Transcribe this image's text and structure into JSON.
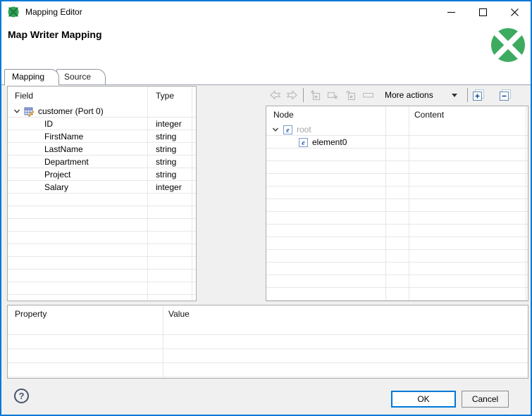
{
  "window": {
    "title": "Mapping Editor",
    "controls": {
      "minimize": "minimize",
      "maximize": "maximize",
      "close": "close"
    }
  },
  "header": {
    "title": "Map Writer Mapping"
  },
  "tabs": [
    {
      "label": "Mapping",
      "active": true
    },
    {
      "label": "Source",
      "active": false
    }
  ],
  "field_table": {
    "columns": [
      "Field",
      "Type"
    ],
    "root": {
      "label": "customer (Port 0)",
      "type": ""
    },
    "rows": [
      {
        "field": "ID",
        "type": "integer"
      },
      {
        "field": "FirstName",
        "type": "string"
      },
      {
        "field": "LastName",
        "type": "string"
      },
      {
        "field": "Department",
        "type": "string"
      },
      {
        "field": "Project",
        "type": "string"
      },
      {
        "field": "Salary",
        "type": "integer"
      }
    ]
  },
  "toolbar": {
    "more_actions_label": "More actions",
    "icons": [
      "map-arrow-left",
      "map-arrow-right",
      "add-child-element",
      "add-element",
      "add-wildcard-element",
      "remove-bar",
      "expand-all",
      "collapse-all"
    ]
  },
  "node_table": {
    "columns": [
      "Node",
      "Content"
    ],
    "rows": [
      {
        "label": "root",
        "level": 0,
        "grayed": true
      },
      {
        "label": "element0",
        "level": 1,
        "grayed": false
      }
    ]
  },
  "property_table": {
    "columns": [
      "Property",
      "Value"
    ]
  },
  "footer": {
    "help_label": "?",
    "ok_label": "OK",
    "cancel_label": "Cancel"
  },
  "colors": {
    "accent": "#0078d7",
    "clover_green": "#3dab5f",
    "clover_dark_green": "#1c7d3c",
    "disabled_icon": "#bdbdbd",
    "grid_line": "#e7e7e7",
    "content_bg": "#f0f0f0"
  }
}
